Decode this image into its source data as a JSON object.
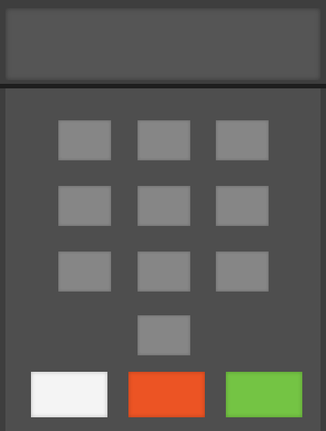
{
  "colors": {
    "body": "#3e3e3e",
    "display": "#555555",
    "keypad_panel": "#4e4e4e",
    "digit_key": "#868686",
    "clear_key": "#f4f4f4",
    "cancel_key": "#ec5424",
    "enter_key": "#74c444"
  },
  "display": {
    "text": ""
  },
  "keypad": {
    "digit_keys": [
      "",
      "",
      "",
      "",
      "",
      "",
      "",
      "",
      "",
      ""
    ]
  },
  "function_keys": {
    "clear_label": "",
    "cancel_label": "",
    "enter_label": ""
  }
}
